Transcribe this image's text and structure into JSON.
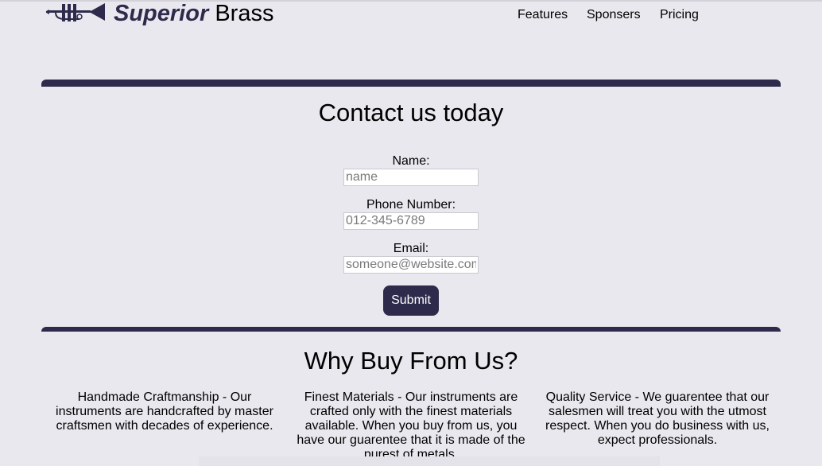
{
  "header": {
    "brand_bold": "Superior",
    "brand_rest": "Brass",
    "nav": [
      "Features",
      "Sponsers",
      "Pricing"
    ]
  },
  "contact": {
    "title": "Contact us today",
    "name_label": "Name:",
    "name_placeholder": "name",
    "phone_label": "Phone Number:",
    "phone_placeholder": "012-345-6789",
    "email_label": "Email:",
    "email_placeholder": "someone@website.com",
    "submit_label": "Submit"
  },
  "why": {
    "title": "Why Buy From Us?",
    "features": [
      "Handmade Craftmanship - Our instruments are handcrafted by master craftsmen with decades of experience.",
      "Finest Materials - Our instruments are crafted only with the finest materials available. When you buy from us, you have our guarentee that it is made of the purest of metals.",
      "Quality Service - We guarentee that our salesmen will treat you with the utmost respect. When you do business with us, expect professionals."
    ]
  },
  "colors": {
    "accent": "#2e2a4c",
    "background": "#e9e8ee"
  },
  "icons": {
    "logo": "trumpet-icon"
  }
}
